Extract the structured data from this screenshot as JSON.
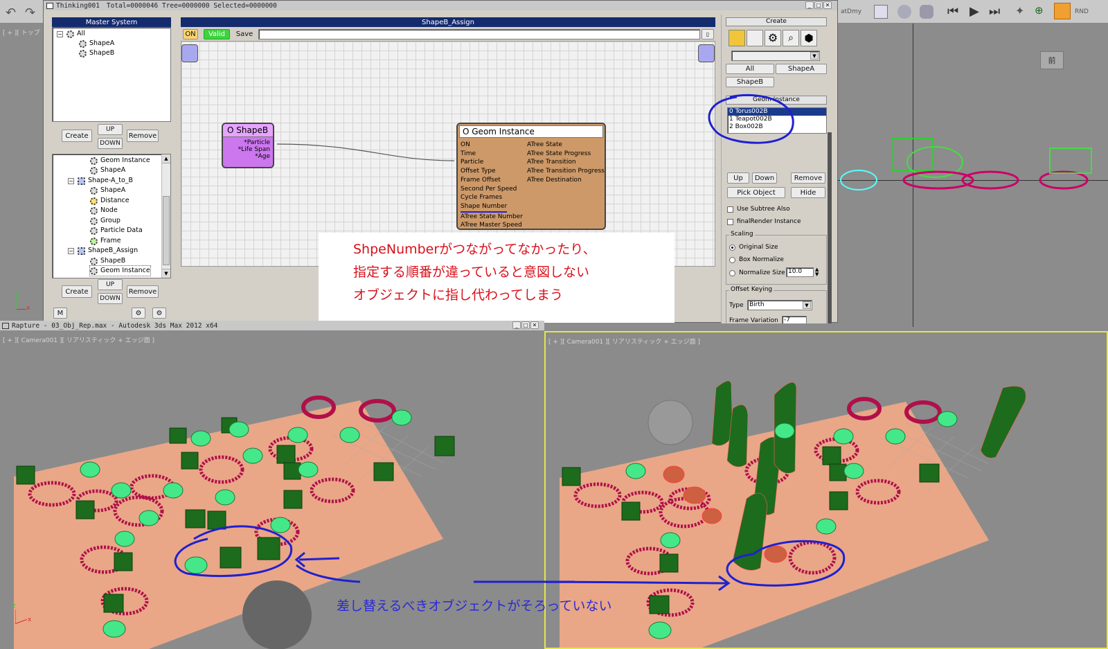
{
  "window": {
    "title": "Thinking001",
    "stats": "Total=0000046   Tree=0000000   Selected=0000000"
  },
  "master": {
    "title": "Master System",
    "tree": [
      "All",
      "ShapeA",
      "ShapeB"
    ],
    "buttons": {
      "create": "Create",
      "up": "UP",
      "down": "DOWN",
      "remove": "Remove"
    }
  },
  "lower_tree": {
    "items": [
      "Geom Instance",
      "ShapeA",
      "Shape-A_to_B",
      "ShapeA",
      "Distance",
      "Node",
      "Group",
      "Particle Data",
      "Frame",
      "ShapeB_Assign",
      "ShapeB",
      "Geom Instance"
    ],
    "buttons": {
      "create": "Create",
      "up": "UP",
      "down": "DOWN",
      "remove": "Remove",
      "m": "M"
    }
  },
  "graph": {
    "title": "ShapeB_Assign",
    "toolbar": {
      "on": "ON",
      "valid": "Valid",
      "save": "Save"
    },
    "node_shapeb": {
      "title": "O ShapeB",
      "outputs": [
        "*Particle",
        "*Life Span",
        "*Age"
      ]
    },
    "node_geom": {
      "title": "O Geom Instance",
      "left": [
        "ON",
        "Time",
        "Particle",
        "Offset Type",
        "Frame Offset",
        "Second Per Speed",
        "Cycle Frames",
        "Shape Number",
        "ATree State Number",
        "ATree Master Speed"
      ],
      "right": [
        "ATree State",
        "ATree State Progress",
        "ATree Transition",
        "ATree Transition Progress",
        "ATree Destination"
      ]
    }
  },
  "note": {
    "lines": [
      "ShpeNumberがつながってなかったり、",
      "指定する順番が違っていると意図しない",
      "オブジェクトに指し代わってしまう"
    ]
  },
  "create_panel": {
    "title": "Create",
    "filters": [
      "All",
      "ShapeA",
      "ShapeB"
    ],
    "geom_title": "Geom Instance",
    "list": [
      "0 Torus002B",
      "1 Teapot002B",
      "2 Box002B"
    ],
    "buttons": {
      "up": "Up",
      "down": "Down",
      "remove": "Remove",
      "pick": "Pick Object",
      "hide": "Hide"
    },
    "checks": [
      "Use Subtree Also",
      "finalRender Instance"
    ],
    "scaling": {
      "title": "Scaling",
      "options": [
        "Original Size",
        "Box Normalize",
        "Normalize Size"
      ],
      "normalize_value": "10.0"
    },
    "offset": {
      "title": "Offset Keying",
      "type_label": "Type",
      "type_value": "Birth",
      "variation_label": "Frame Variation",
      "variation_value": "-7"
    }
  },
  "max": {
    "title": "Rapture - 03_Obj_Rep.max - Autodesk 3ds Max  2012 x64",
    "toolbar_text": [
      "atDmy",
      "RND"
    ],
    "viewport_top_label": "[ + ][ トップ ]",
    "viewport_front_tag": "前",
    "viewport_label": "[ + ][ Camera001 ][ リアリスティック + エッジ面 ]",
    "bottom_note": "差し替えるべきオブジェクトがそろっていない"
  }
}
